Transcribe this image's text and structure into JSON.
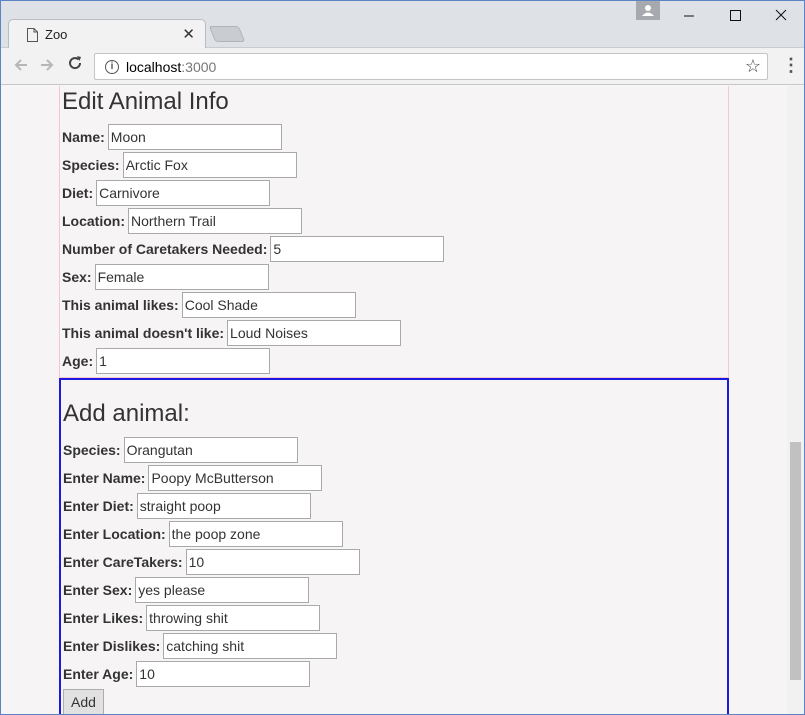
{
  "browser": {
    "tab_title": "Zoo",
    "tab_close": "✕",
    "url_host": "localhost",
    "url_port": ":3000"
  },
  "edit_section": {
    "heading": "Edit Animal Info",
    "fields": [
      {
        "label": "Name:",
        "value": "Moon"
      },
      {
        "label": "Species:",
        "value": "Arctic Fox"
      },
      {
        "label": "Diet:",
        "value": "Carnivore"
      },
      {
        "label": "Location:",
        "value": "Northern Trail"
      },
      {
        "label": "Number of Caretakers Needed:",
        "value": "5"
      },
      {
        "label": "Sex:",
        "value": "Female"
      },
      {
        "label": "This animal likes:",
        "value": "Cool Shade"
      },
      {
        "label": "This animal doesn't like:",
        "value": "Loud Noises"
      },
      {
        "label": "Age:",
        "value": "1"
      }
    ]
  },
  "add_section": {
    "heading": "Add animal:",
    "fields": [
      {
        "label": "Species:",
        "value": "Orangutan"
      },
      {
        "label": "Enter Name:",
        "value": "Poopy McButterson"
      },
      {
        "label": "Enter Diet:",
        "value": "straight poop"
      },
      {
        "label": "Enter Location:",
        "value": "the poop zone"
      },
      {
        "label": "Enter CareTakers:",
        "value": "10"
      },
      {
        "label": "Enter Sex:",
        "value": "yes please"
      },
      {
        "label": "Enter Likes:",
        "value": "throwing shit"
      },
      {
        "label": "Enter Dislikes:",
        "value": "catching shit"
      },
      {
        "label": "Enter Age:",
        "value": "10"
      }
    ],
    "button_label": "Add"
  },
  "colors": {
    "edit_border": "#f7c5cf",
    "add_border": "#1a1ae0"
  }
}
